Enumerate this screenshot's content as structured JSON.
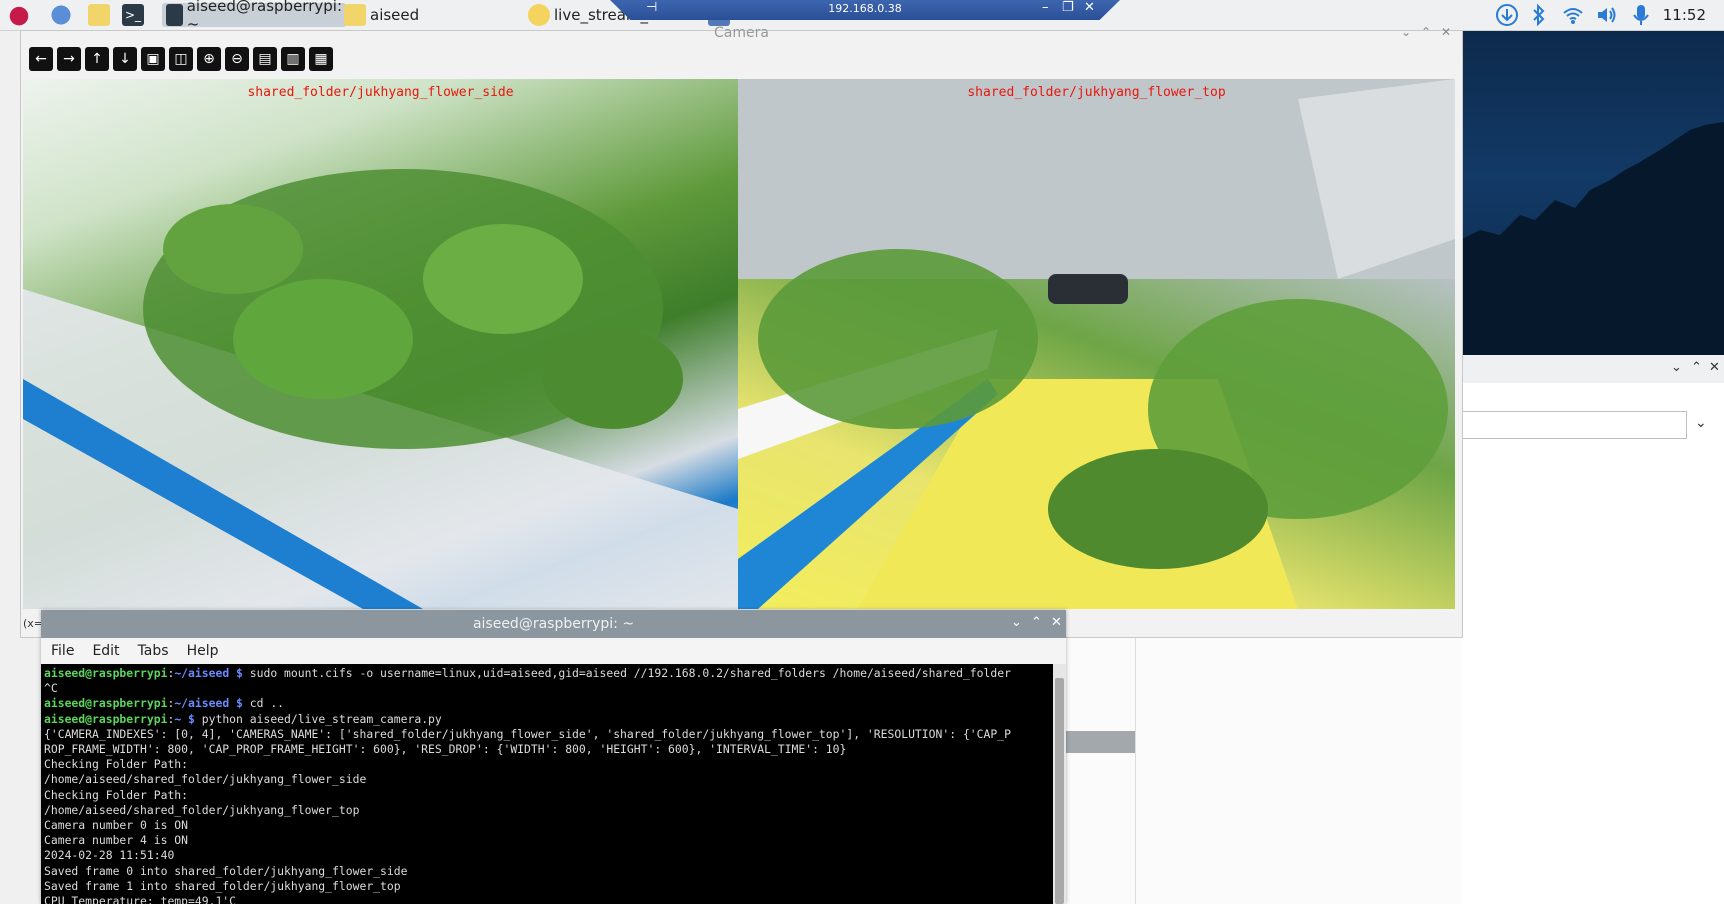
{
  "taskbar": {
    "items": [
      {
        "label": "aiseed@raspberrypi: ~",
        "active": true
      },
      {
        "label": "aiseed",
        "active": false
      },
      {
        "label": "live_stream_camera",
        "active": false
      },
      {
        "label": "Camera",
        "active": false
      }
    ],
    "rdp_host": "192.168.0.38",
    "clock": "11:52"
  },
  "camera_window": {
    "title": "Camera",
    "toolbar": [
      "pan-left-icon",
      "pan-right-icon",
      "pan-up-icon",
      "pan-down-icon",
      "zoom-fit-icon",
      "zoom-rect-icon",
      "zoom-in-icon",
      "zoom-out-icon",
      "save-icon",
      "copy-icon",
      "properties-icon"
    ],
    "left_image_label": "shared_folder/jukhyang_flower_side",
    "right_image_label": "shared_folder/jukhyang_flower_top",
    "status": "(x="
  },
  "terminal": {
    "title": "aiseed@raspberrypi: ~",
    "menu": [
      "File",
      "Edit",
      "Tabs",
      "Help"
    ],
    "lines": [
      {
        "prompt_user": "aiseed@raspberrypi",
        "prompt_path": "~/aiseed $",
        "text": " sudo mount.cifs -o username=linux,uid=aiseed,gid=aiseed //192.168.0.2/shared_folders /home/aiseed/shared_folder"
      },
      {
        "text": "^C"
      },
      {
        "prompt_user": "aiseed@raspberrypi",
        "prompt_path": "~/aiseed $",
        "text": " cd .."
      },
      {
        "prompt_user": "aiseed@raspberrypi",
        "prompt_path": "~ $",
        "text": " python aiseed/live_stream_camera.py"
      },
      {
        "text": "{'CAMERA_INDEXES': [0, 4], 'CAMERAS_NAME': ['shared_folder/jukhyang_flower_side', 'shared_folder/jukhyang_flower_top'], 'RESOLUTION': {'CAP_P"
      },
      {
        "text": "ROP_FRAME_WIDTH': 800, 'CAP_PROP_FRAME_HEIGHT': 600}, 'RES_DROP': {'WIDTH': 800, 'HEIGHT': 600}, 'INTERVAL_TIME': 10}"
      },
      {
        "text": "Checking Folder Path:"
      },
      {
        "text": "/home/aiseed/shared_folder/jukhyang_flower_side"
      },
      {
        "text": "Checking Folder Path:"
      },
      {
        "text": "/home/aiseed/shared_folder/jukhyang_flower_top"
      },
      {
        "text": "Camera number 0 is ON"
      },
      {
        "text": "Camera number 4 is ON"
      },
      {
        "text": "2024-02-28 11:51:40"
      },
      {
        "text": "Saved frame 0 into shared_folder/jukhyang_flower_side"
      },
      {
        "text": "Saved frame 1 into shared_folder/jukhyang_flower_top"
      },
      {
        "text": "CPU Temperature: temp=49.1'C"
      }
    ]
  },
  "colors": {
    "terminal_bg": "#000000",
    "prompt_user": "#5cd65c",
    "prompt_path": "#6b8cff",
    "image_label": "#e8160c",
    "taskbar_bg": "#eef0f2"
  }
}
